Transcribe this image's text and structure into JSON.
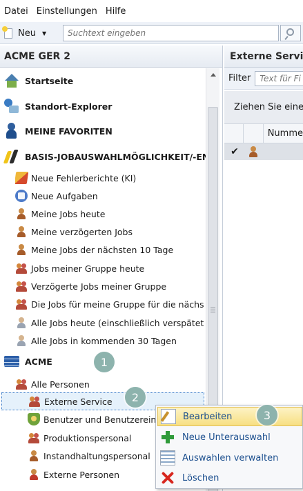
{
  "menubar": {
    "items": [
      "Datei",
      "Einstellungen",
      "Hilfe"
    ]
  },
  "toolbar": {
    "new_label": "Neu",
    "search_placeholder": "Suchtext eingeben"
  },
  "left_pane": {
    "title": "ACME GER 2",
    "top_items": [
      {
        "label": "Startseite",
        "icon": "home-icon"
      },
      {
        "label": "Standort-Explorer",
        "icon": "location-explorer-icon"
      },
      {
        "label": "MEINE FAVORITEN",
        "icon": "favorites-icon"
      },
      {
        "label": "BASIS-JOBAUSWAHLMÖGLICHKEIT/-EN",
        "icon": "job-selection-icon"
      }
    ],
    "job_items": [
      {
        "label": "Neue Fehlerberichte (KI)",
        "icon": "error-report-icon"
      },
      {
        "label": "Neue Aufgaben",
        "icon": "task-icon"
      },
      {
        "label": "Meine Jobs heute",
        "icon": "person-icon"
      },
      {
        "label": "Meine verzögerten Jobs",
        "icon": "person-icon"
      },
      {
        "label": "Meine Jobs der nächsten 10 Tage",
        "icon": "person-icon"
      },
      {
        "label": "Jobs meiner Gruppe heute",
        "icon": "group-icon"
      },
      {
        "label": "Verzögerte Jobs meiner Gruppe",
        "icon": "group-icon"
      },
      {
        "label": "Die Jobs für meine Gruppe für die nächs",
        "icon": "group-icon"
      },
      {
        "label": "Alle Jobs heute (einschließlich verspätet",
        "icon": "person-gray-icon"
      },
      {
        "label": "Alle Jobs in kommenden 30 Tagen",
        "icon": "person-gray-icon"
      }
    ],
    "acme": {
      "label": "ACME",
      "icon": "server-icon"
    },
    "people": {
      "label": "Alle Personen",
      "icon": "group-icon"
    },
    "people_items": [
      {
        "label": "Externe Service",
        "icon": "group-icon"
      },
      {
        "label": "Benutzer und Benutzerein",
        "icon": "shield-icon"
      },
      {
        "label": "Produktionspersonal",
        "icon": "group-icon"
      },
      {
        "label": "Instandhaltungspersonal",
        "icon": "person-icon"
      },
      {
        "label": "Externe Personen",
        "icon": "person-red-icon"
      }
    ]
  },
  "right_pane": {
    "title": "Externe Servic",
    "filter_label": "Filter",
    "filter_placeholder": "Text für Fi",
    "group_hint": "Ziehen Sie eine",
    "column_header": "Numme"
  },
  "context_menu": {
    "items": [
      {
        "label": "Bearbeiten",
        "icon": "edit-icon",
        "highlighted": true
      },
      {
        "label": "Neue Unterauswahl",
        "icon": "add-icon"
      },
      {
        "label": "Auswahlen verwalten",
        "icon": "manage-selections-icon"
      },
      {
        "label": "Löschen",
        "icon": "delete-icon"
      }
    ]
  },
  "badges": [
    "1",
    "2",
    "3"
  ],
  "colors": {
    "badge": "#8db3ad",
    "selection": "#e5f1fb",
    "menu_highlight": "#f7df82"
  }
}
